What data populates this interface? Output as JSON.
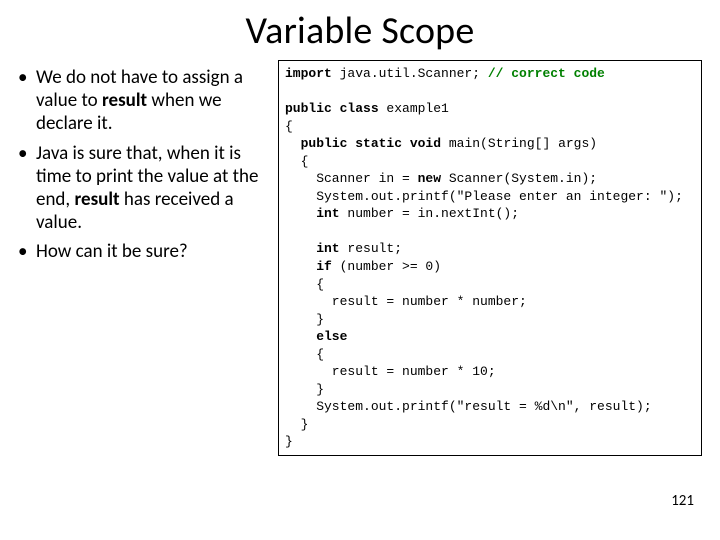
{
  "title": "Variable Scope",
  "bullets": {
    "b1_pre": "We do not have to assign a value to ",
    "b1_bold": "result",
    "b1_post": " when we declare it.",
    "b2_pre": "Java is sure that, when it is time to print the value at the end, ",
    "b2_bold": "result",
    "b2_post": " has received a value.",
    "b3": "How can it be sure?"
  },
  "code": {
    "l01_kw": "import",
    "l01_rest": " java.util.Scanner; ",
    "l01_cm": "// correct code",
    "l02": "",
    "l03_kw": "public class",
    "l03_rest": " example1",
    "l04": "{",
    "l05_ind": "  ",
    "l05_kw": "public static void",
    "l05_rest": " main(String[] args)",
    "l06": "  {",
    "l07_ind": "    Scanner in = ",
    "l07_kw": "new",
    "l07_rest": " Scanner(System.in);",
    "l08": "    System.out.printf(\"Please enter an integer: \");",
    "l09_kw": "    int",
    "l09_rest": " number = in.nextInt();",
    "l10": "",
    "l11_kw": "    int",
    "l11_rest": " result;",
    "l12_kw": "    if",
    "l12_rest": " (number >= 0)",
    "l13": "    {",
    "l14": "      result = number * number;",
    "l15": "    }",
    "l16_kw": "    else",
    "l17": "    {",
    "l18": "      result = number * 10;",
    "l19": "    }",
    "l20": "    System.out.printf(\"result = %d\\n\", result);",
    "l21": "  }",
    "l22": "}"
  },
  "page_number": "121"
}
